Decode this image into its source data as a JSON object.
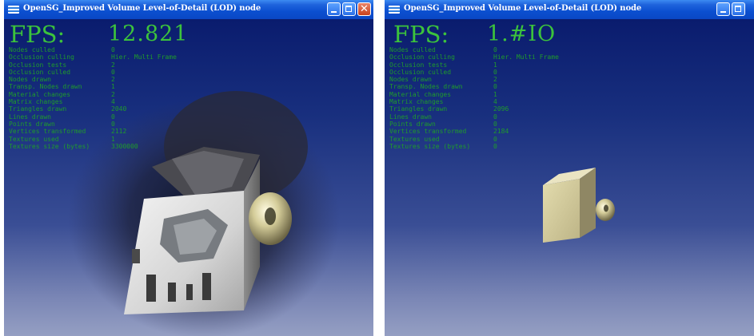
{
  "windows": [
    {
      "title": "OpenSG_Improved Volume Level-of-Detail (LOD) node",
      "fps_label": "FPS:",
      "fps_value": "12.821",
      "stats": [
        {
          "key": "Nodes culled",
          "value": "0"
        },
        {
          "key": "Occlusion culling",
          "value": "Hier. Multi Frame"
        },
        {
          "key": "Occlusion tests",
          "value": "2"
        },
        {
          "key": "Occlusion culled",
          "value": "0"
        },
        {
          "key": "Nodes drawn",
          "value": "2"
        },
        {
          "key": "Transp. Nodes drawn",
          "value": "1"
        },
        {
          "key": "Material changes",
          "value": "2"
        },
        {
          "key": "Matrix changes",
          "value": "4"
        },
        {
          "key": "Triangles drawn",
          "value": "2040"
        },
        {
          "key": "Lines drawn",
          "value": "0"
        },
        {
          "key": "Points drawn",
          "value": "0"
        },
        {
          "key": "Vertices transformed",
          "value": "2112"
        },
        {
          "key": "Textures used",
          "value": "1"
        },
        {
          "key": "Textures size (bytes)",
          "value": "3300000"
        }
      ]
    },
    {
      "title": "OpenSG_Improved Volume Level-of-Detail (LOD) node",
      "fps_label": "FPS:",
      "fps_value": "1.#IO",
      "stats": [
        {
          "key": "Nodes culled",
          "value": "0"
        },
        {
          "key": "Occlusion culling",
          "value": "Hier. Multi Frame"
        },
        {
          "key": "Occlusion tests",
          "value": "1"
        },
        {
          "key": "Occlusion culled",
          "value": "0"
        },
        {
          "key": "Nodes drawn",
          "value": "2"
        },
        {
          "key": "Transp. Nodes drawn",
          "value": "0"
        },
        {
          "key": "Material changes",
          "value": "1"
        },
        {
          "key": "Matrix changes",
          "value": "4"
        },
        {
          "key": "Triangles drawn",
          "value": "2096"
        },
        {
          "key": "Lines drawn",
          "value": "0"
        },
        {
          "key": "Points drawn",
          "value": "0"
        },
        {
          "key": "Vertices transformed",
          "value": "2184"
        },
        {
          "key": "Textures used",
          "value": "0"
        },
        {
          "key": "Textures size (bytes)",
          "value": "0"
        }
      ]
    }
  ],
  "colors": {
    "overlay_text": "#1f9b2c",
    "fps_text": "#3cc33c",
    "titlebar": "#0b4fd0",
    "model_gray": "#d8d8d8",
    "model_tan": "#cfc89a"
  }
}
